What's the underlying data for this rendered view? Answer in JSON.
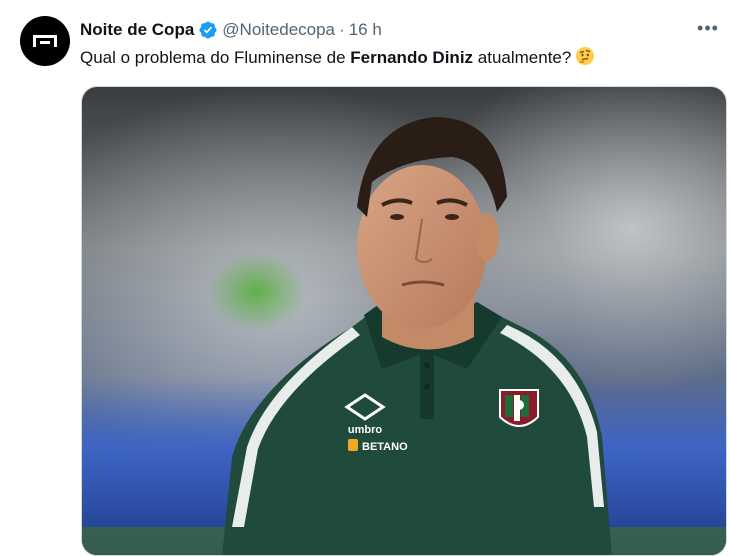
{
  "author": {
    "display_name": "Noite de Copa",
    "handle": "@Noitedecopa",
    "separator": "·",
    "time": "16 h",
    "verified": true
  },
  "tweet": {
    "text_before": "Qual o problema do Fluminense de ",
    "text_bold": "Fernando Diniz",
    "text_after": " atualmente?",
    "emoji": "thinking-face"
  },
  "actions": {
    "more_label": "•••"
  },
  "media": {
    "description_icon": "photo",
    "shirt_brand_text": "umbro",
    "sponsor_text": "BETANO"
  },
  "colors": {
    "accent": "#1d9bf0",
    "text_primary": "#0f1419",
    "text_secondary": "#536471",
    "shirt_green": "#1f4a3c"
  }
}
